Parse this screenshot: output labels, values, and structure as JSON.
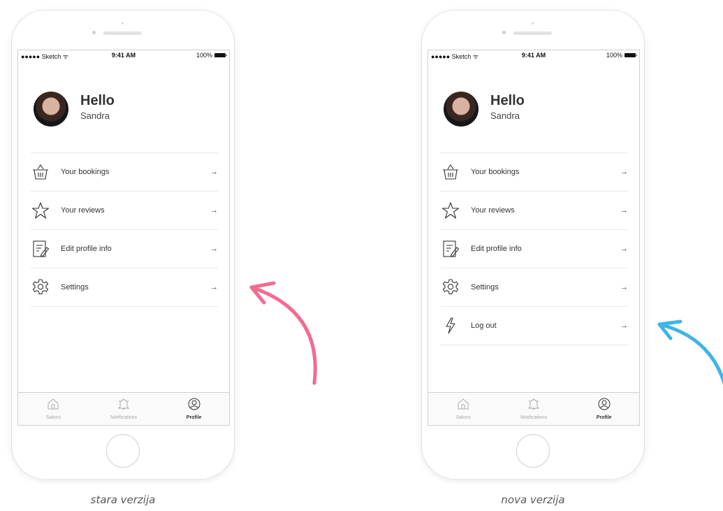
{
  "status_bar": {
    "carrier": "●●●●● Sketch",
    "time": "9:41 AM",
    "battery": "100%"
  },
  "profile": {
    "greeting": "Hello",
    "name": "Sandra"
  },
  "old_version": {
    "caption": "stara verzija",
    "menu": [
      {
        "label": "Your bookings",
        "icon": "basket-icon",
        "arrow": "→"
      },
      {
        "label": "Your reviews",
        "icon": "star-icon",
        "arrow": "→"
      },
      {
        "label": "Edit profile info",
        "icon": "edit-document-icon",
        "arrow": "→"
      },
      {
        "label": "Settings",
        "icon": "gear-icon",
        "arrow": "→"
      }
    ]
  },
  "new_version": {
    "caption": "nova verzija",
    "menu": [
      {
        "label": "Your bookings",
        "icon": "basket-icon",
        "arrow": "→"
      },
      {
        "label": "Your reviews",
        "icon": "star-icon",
        "arrow": "→"
      },
      {
        "label": "Edit profile info",
        "icon": "edit-document-icon",
        "arrow": "→"
      },
      {
        "label": "Settings",
        "icon": "gear-icon",
        "arrow": "→"
      },
      {
        "label": "Log out",
        "icon": "lightning-icon",
        "arrow": "→"
      }
    ]
  },
  "tabbar": {
    "tabs": [
      {
        "label": "Salons",
        "icon": "home-icon",
        "active": false
      },
      {
        "label": "Notifications",
        "icon": "bell-icon",
        "active": false
      },
      {
        "label": "Profile",
        "icon": "profile-icon",
        "active": true
      }
    ]
  },
  "annotation_arrows": [
    {
      "color": "#f26b8f",
      "points_to": "old_version"
    },
    {
      "color": "#3fb4e6",
      "points_to": "new_version"
    }
  ]
}
